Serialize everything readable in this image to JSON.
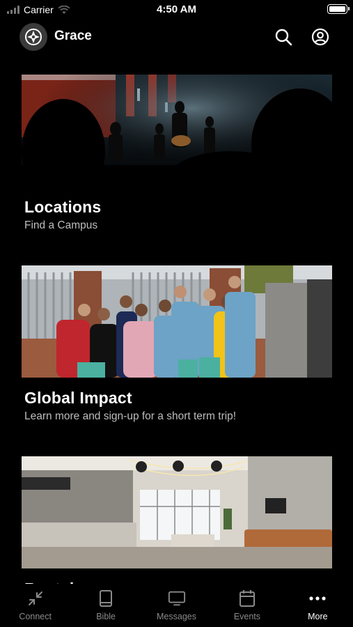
{
  "status_bar": {
    "carrier": "Carrier",
    "time": "4:50 AM"
  },
  "header": {
    "title": "Grace"
  },
  "cards": [
    {
      "title": "Locations",
      "subtitle": "Find a Campus"
    },
    {
      "title": "Global Impact",
      "subtitle": "Learn more and sign-up for a short term trip!"
    },
    {
      "title": "Rentals",
      "subtitle": ""
    }
  ],
  "tabs": [
    {
      "label": "Connect",
      "icon": "connect-arrows-icon"
    },
    {
      "label": "Bible",
      "icon": "book-icon"
    },
    {
      "label": "Messages",
      "icon": "tv-icon"
    },
    {
      "label": "Events",
      "icon": "calendar-icon"
    },
    {
      "label": "More",
      "icon": "more-dots-icon"
    }
  ],
  "colors": {
    "background": "#000000",
    "text": "#ffffff",
    "subtitle": "#bdbdbd",
    "inactive_tab": "#8a8a8a"
  }
}
